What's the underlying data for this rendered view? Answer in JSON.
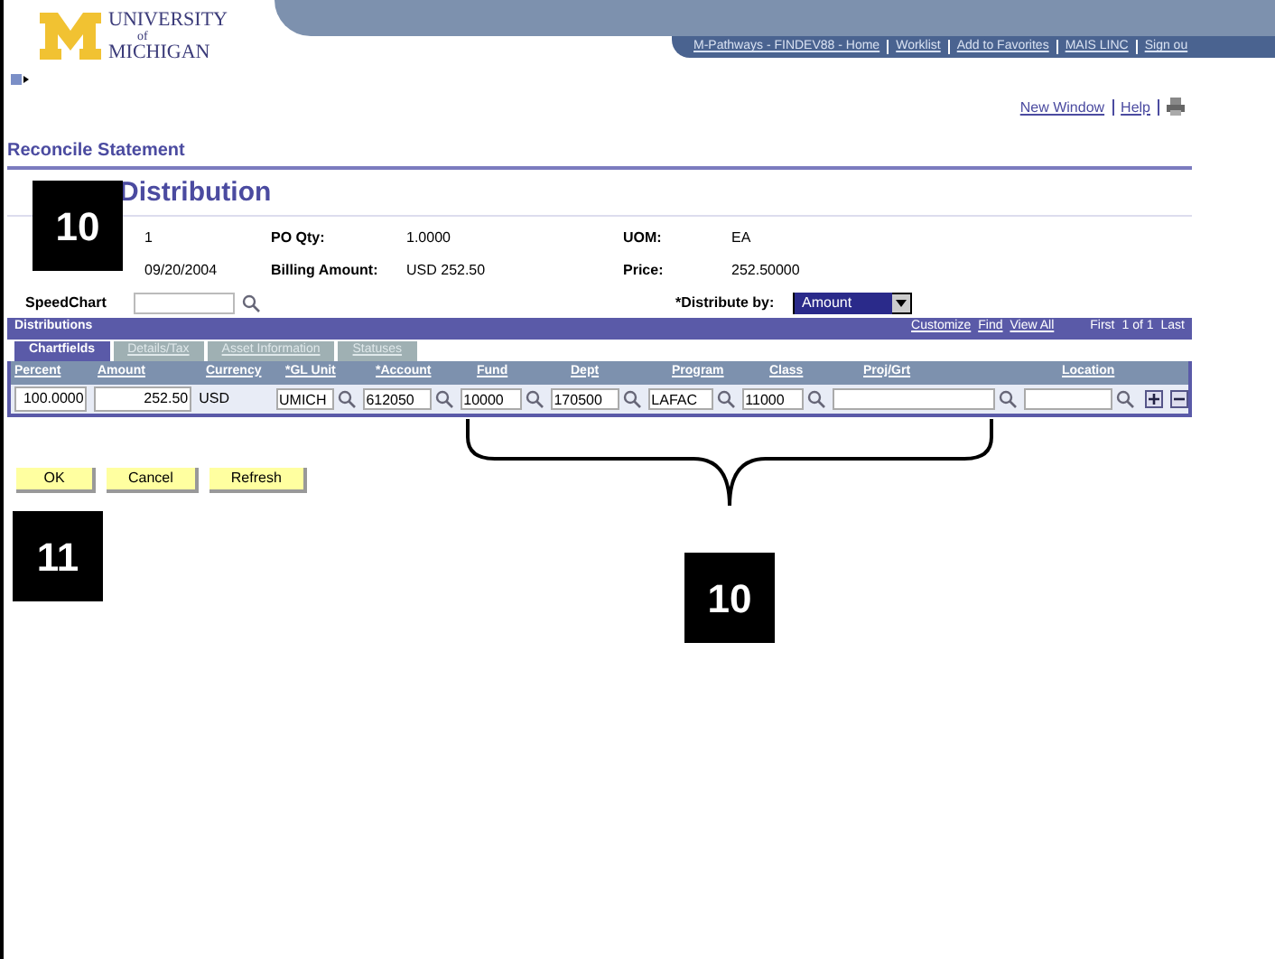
{
  "header": {
    "logo_top": "UNIVERSITY",
    "logo_mid": "of",
    "logo_bottom": "MICHIGAN",
    "nav_links": [
      "M-Pathways - FINDEV88 - Home",
      "Worklist",
      "Add to Favorites",
      "MAIS LINC",
      "Sign ou"
    ],
    "page_links": [
      "New Window",
      "Help"
    ]
  },
  "breadcrumb": "Reconcile Statement",
  "title": "Distribution",
  "fields": [
    {
      "value": "1",
      "label": "PO Qty:",
      "value2": "1.0000",
      "label3": "UOM:",
      "value3": "EA"
    },
    {
      "value": "09/20/2004",
      "label": "Billing Amount:",
      "value2": "USD  252.50",
      "label3": "Price:",
      "value3": "252.50000"
    }
  ],
  "speedchart": {
    "label": "SpeedChart"
  },
  "distribute_by": {
    "label": "*Distribute by:",
    "value": "Amount"
  },
  "grid": {
    "title": "Distributions",
    "links": [
      "Customize",
      "Find",
      "View All"
    ],
    "nav": [
      "First",
      "1 of 1",
      "Last"
    ],
    "tabs": [
      {
        "label": "Chartfields",
        "selected": true
      },
      {
        "label": "Details/Tax",
        "selected": false
      },
      {
        "label": "Asset Information",
        "selected": false
      },
      {
        "label": "Statuses",
        "selected": false
      }
    ],
    "columns": [
      "Percent",
      "Amount",
      "Currency",
      "*GL Unit",
      "*Account",
      "Fund",
      "Dept",
      "Program",
      "Class",
      "Proj/Grt",
      "Location"
    ],
    "row": [
      {
        "kind": "input",
        "value": "100.0000"
      },
      {
        "kind": "input",
        "value": "252.50"
      },
      {
        "kind": "text",
        "value": "USD"
      },
      {
        "kind": "lookup",
        "value": "UMICH"
      },
      {
        "kind": "lookup",
        "value": "612050"
      },
      {
        "kind": "lookup",
        "value": "10000"
      },
      {
        "kind": "lookup",
        "value": "170500"
      },
      {
        "kind": "lookup",
        "value": "LAFAC"
      },
      {
        "kind": "lookup",
        "value": "11000"
      },
      {
        "kind": "lookup"
      },
      {
        "kind": "lookup"
      }
    ]
  },
  "buttons": [
    "OK",
    "Cancel",
    "Refresh"
  ],
  "callouts": [
    {
      "label": "10",
      "kind": "top"
    },
    {
      "label": "11",
      "kind": "left"
    },
    {
      "label": "10",
      "kind": "brace"
    }
  ]
}
